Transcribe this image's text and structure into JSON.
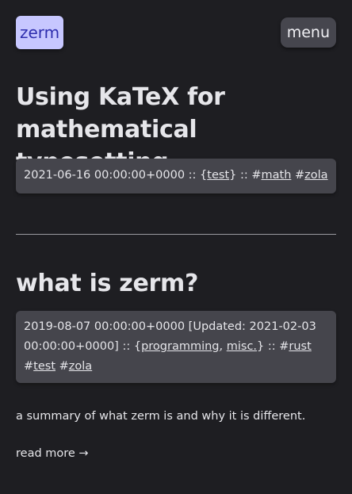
{
  "header": {
    "logo": "zerm",
    "menu_label": "menu"
  },
  "posts": [
    {
      "title": "Using KaTeX for mathematical typesetting",
      "date": "2021-06-16 00:00:00+0000",
      "sep1": " :: {",
      "categories": [
        "test"
      ],
      "sep2": "} :: #",
      "tags": [
        "math",
        "zola"
      ]
    },
    {
      "title": "what is zerm?",
      "date": "2019-08-07 00:00:00+0000",
      "updated": " [Updated: 2021-02-03 00:00:00+0000]",
      "sep1": " :: {",
      "categories": [
        "programming",
        "misc."
      ],
      "sep2": "} :: #",
      "tags": [
        "rust",
        "test",
        "zola"
      ],
      "summary": "a summary of what zerm is and why it is different.",
      "read_more": "read more →"
    }
  ]
}
